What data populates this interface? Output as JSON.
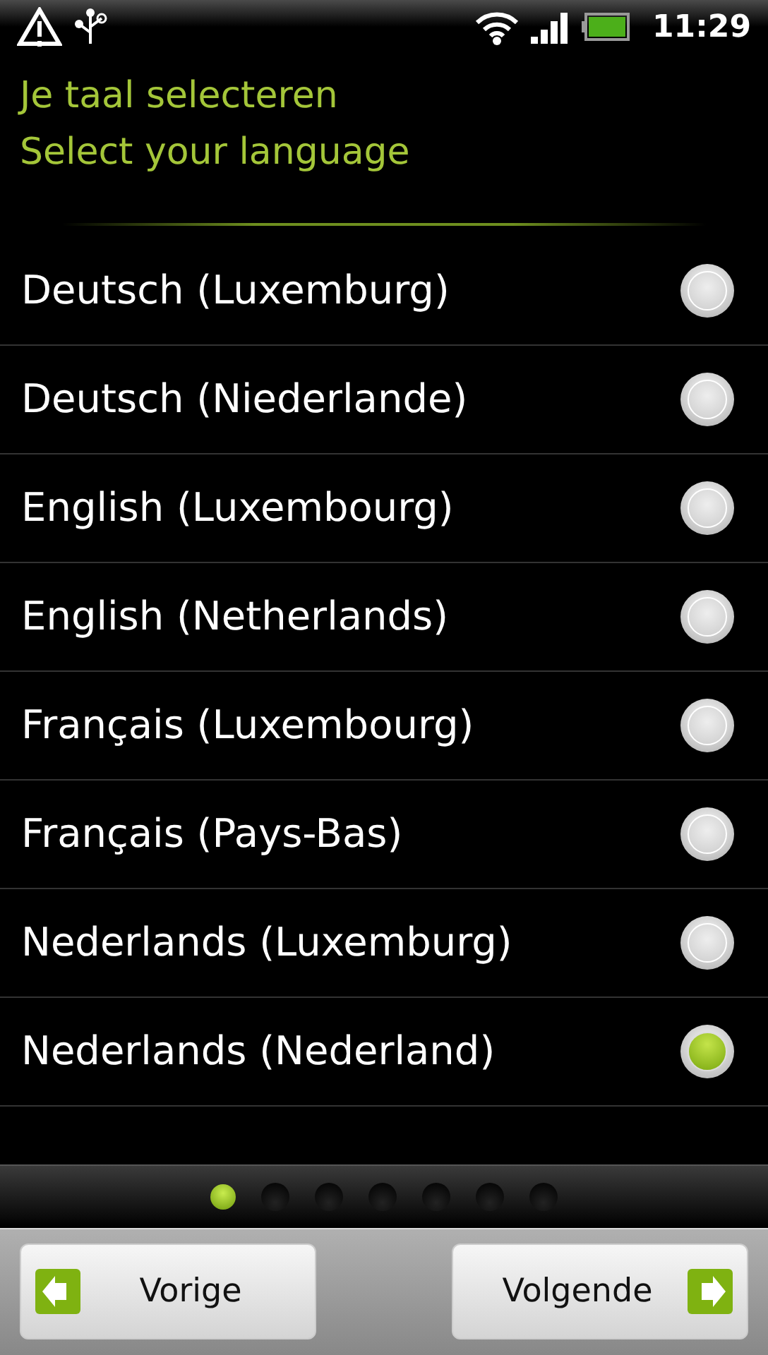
{
  "status_bar": {
    "time": "11:29"
  },
  "header": {
    "lines": [
      "Je taal selecteren",
      "Select your language"
    ]
  },
  "languages": [
    {
      "label": "Deutsch (Luxemburg)",
      "selected": false
    },
    {
      "label": "Deutsch (Niederlande)",
      "selected": false
    },
    {
      "label": "English (Luxembourg)",
      "selected": false
    },
    {
      "label": "English (Netherlands)",
      "selected": false
    },
    {
      "label": "Français (Luxembourg)",
      "selected": false
    },
    {
      "label": "Français (Pays-Bas)",
      "selected": false
    },
    {
      "label": "Nederlands (Luxemburg)",
      "selected": false
    },
    {
      "label": "Nederlands (Nederland)",
      "selected": true
    }
  ],
  "steps": [
    {
      "selected": true
    },
    {
      "selected": false
    },
    {
      "selected": false
    },
    {
      "selected": false
    },
    {
      "selected": false
    },
    {
      "selected": false
    },
    {
      "selected": false
    }
  ],
  "buttons": [
    {
      "kind": "back",
      "label": "Vorige"
    },
    {
      "kind": "next",
      "label": "Volgende"
    }
  ]
}
